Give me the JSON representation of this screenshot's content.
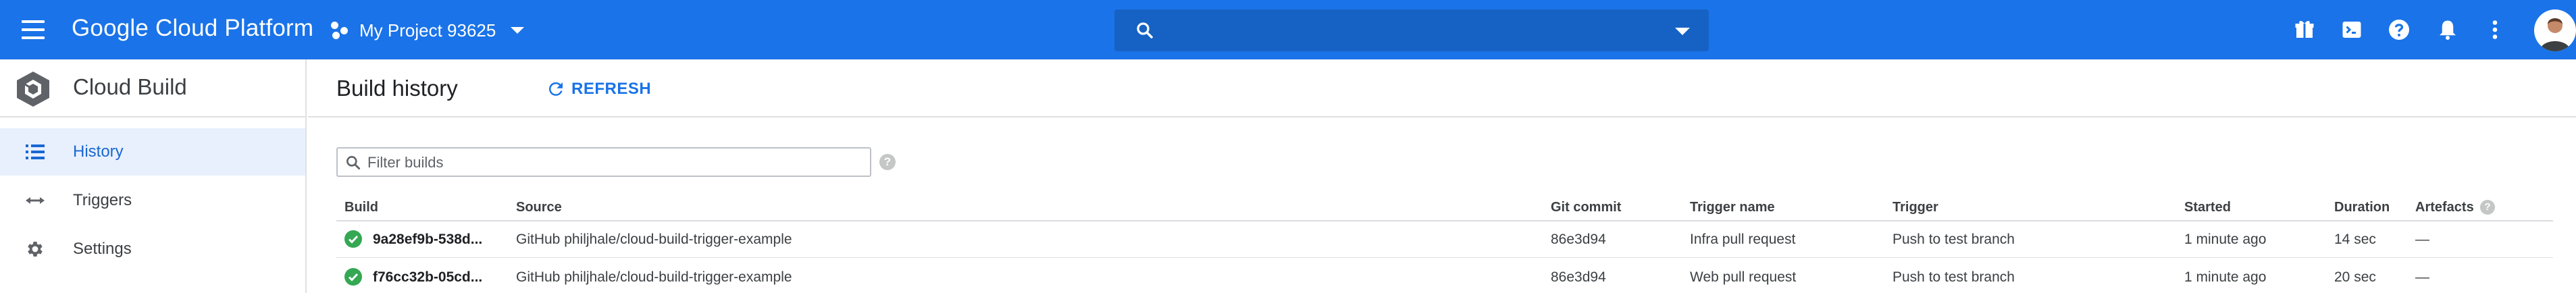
{
  "topbar": {
    "brand": "Google Cloud Platform",
    "project_name": "My Project 93625",
    "search_placeholder": "",
    "icons": [
      "gift-icon",
      "terminal-icon",
      "help-icon",
      "bell-icon",
      "more-vert-icon",
      "avatar"
    ],
    "color": "#1a73e8"
  },
  "sidebar": {
    "title": "Cloud Build",
    "items": [
      {
        "label": "History",
        "icon": "list-icon",
        "active": true
      },
      {
        "label": "Triggers",
        "icon": "arrows-icon",
        "active": false
      },
      {
        "label": "Settings",
        "icon": "gear-icon",
        "active": false
      }
    ]
  },
  "main": {
    "title": "Build history",
    "refresh_label": "REFRESH",
    "filter_placeholder": "Filter builds",
    "columns": [
      "Build",
      "Source",
      "Git commit",
      "Trigger name",
      "Trigger",
      "Started",
      "Duration",
      "Artefacts"
    ],
    "rows": [
      {
        "status": "success",
        "build": "9a28ef9b-538d...",
        "source": "GitHub philjhale/cloud-build-trigger-example",
        "commit": "86e3d94",
        "trigger_name": "Infra pull request",
        "trigger": "Push to test branch",
        "started": "1 minute ago",
        "duration": "14 sec",
        "artefacts": "—"
      },
      {
        "status": "success",
        "build": "f76cc32b-05cd...",
        "source": "GitHub philjhale/cloud-build-trigger-example",
        "commit": "86e3d94",
        "trigger_name": "Web pull request",
        "trigger": "Push to test branch",
        "started": "1 minute ago",
        "duration": "20 sec",
        "artefacts": "—"
      }
    ]
  },
  "colors": {
    "accent": "#1a73e8",
    "success": "#34a853",
    "active_bg": "#e8f0fe"
  }
}
